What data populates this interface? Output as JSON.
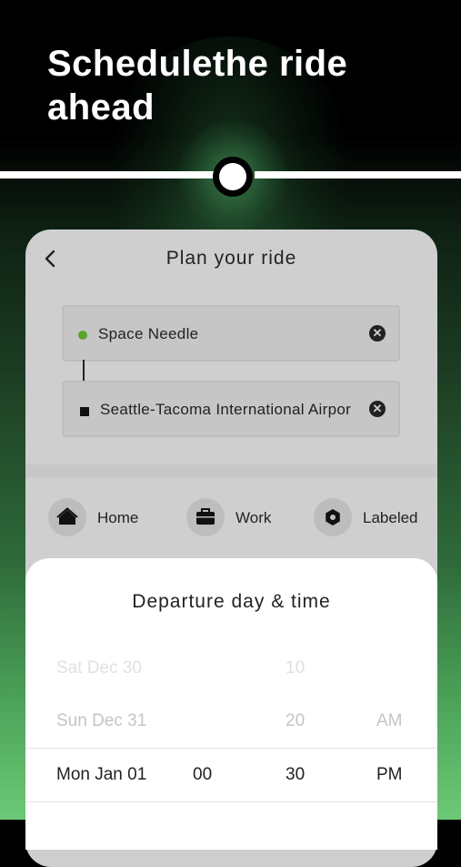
{
  "header": {
    "headline": "Schedulethe ride ahead"
  },
  "app": {
    "title": "Plan your ride",
    "back_icon": "chevron-left-icon",
    "pickup": {
      "label": "Space Needle",
      "marker": "green-dot",
      "clear_icon": "clear-icon"
    },
    "dropoff": {
      "label": "Seattle-Tacoma International Airpor",
      "marker": "black-square",
      "clear_icon": "clear-icon"
    },
    "quick_places": [
      {
        "label": "Home",
        "icon": "home-icon"
      },
      {
        "label": "Work",
        "icon": "briefcase-icon"
      },
      {
        "label": "Labeled",
        "icon": "tag-icon"
      }
    ]
  },
  "sheet": {
    "title": "Departure day & time",
    "rows": [
      {
        "day": "Sat Dec 30",
        "hour": "",
        "minute": "10",
        "ampm": ""
      },
      {
        "day": "Sun Dec 31",
        "hour": "",
        "minute": "20",
        "ampm": "AM"
      },
      {
        "day": "Mon Jan 01",
        "hour": "00",
        "minute": "30",
        "ampm": "PM"
      }
    ]
  },
  "colors": {
    "accent_green": "#5aa52d",
    "background_top": "#000000",
    "background_bottom": "#6cc978"
  }
}
